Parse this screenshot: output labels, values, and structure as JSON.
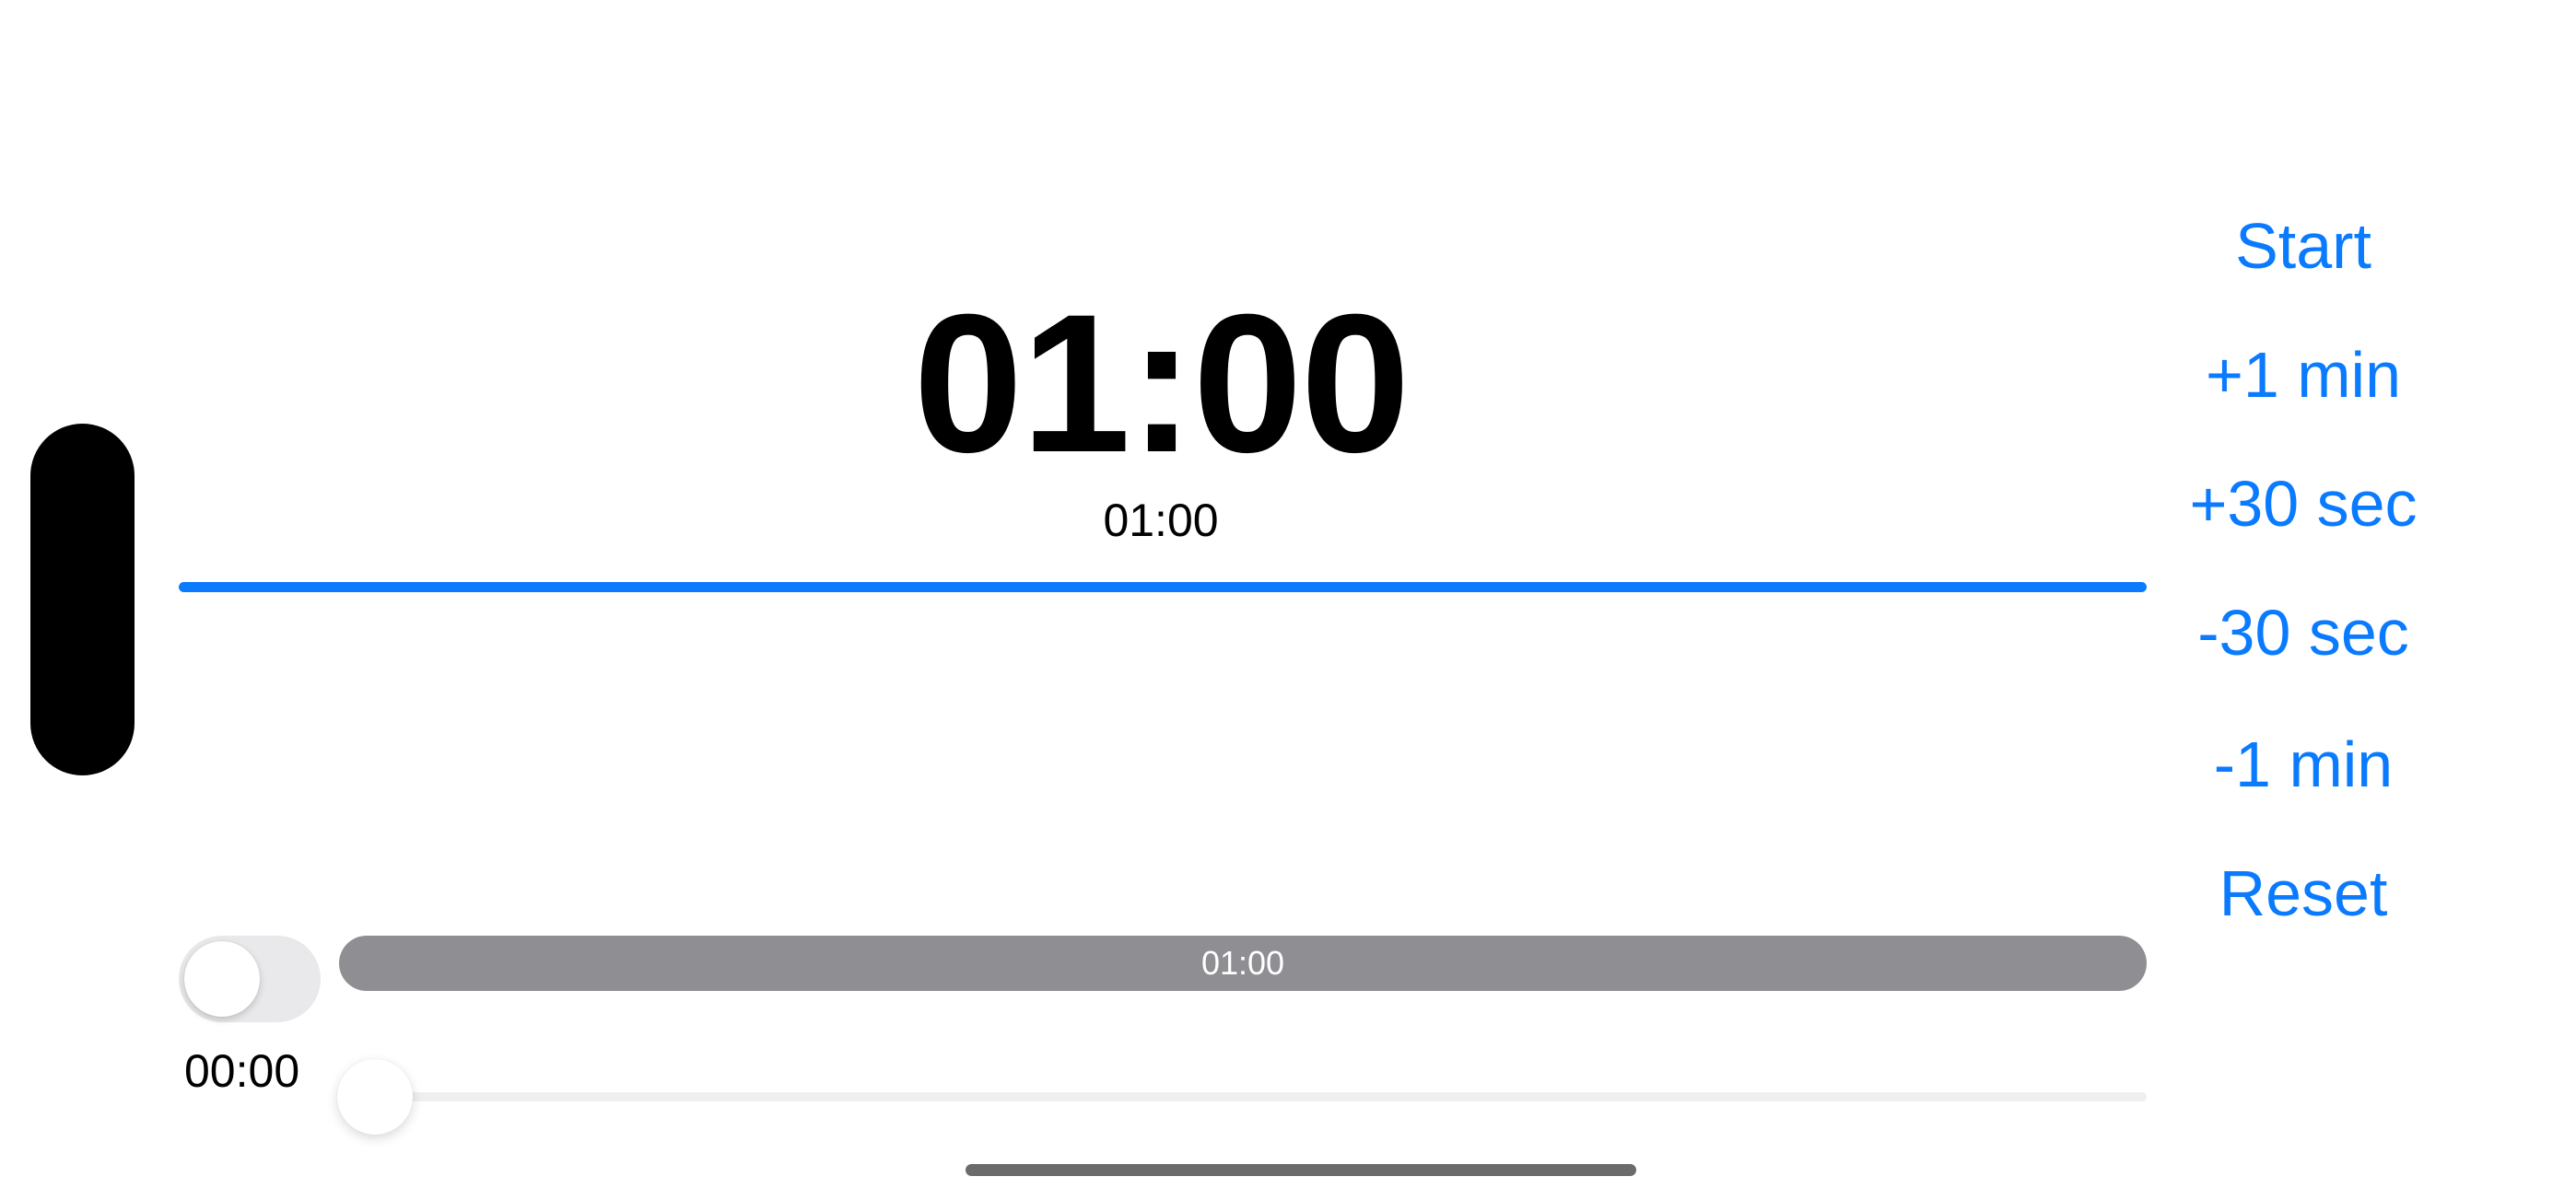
{
  "timer": {
    "main_time": "01:00",
    "sub_time": "01:00",
    "progress_fraction": 1.0
  },
  "controls": {
    "start_label": "Start",
    "plus_1_min_label": "+1 min",
    "plus_30_sec_label": "+30 sec",
    "minus_30_sec_label": "-30 sec",
    "minus_1_min_label": "-1 min",
    "reset_label": "Reset"
  },
  "bottom": {
    "toggle_on": false,
    "bar_label": "01:00",
    "elapsed_label": "00:00",
    "slider_fraction": 0.0
  },
  "colors": {
    "accent": "#0a7aff",
    "text": "#000000",
    "bar_gray": "#8e8e93",
    "toggle_off": "#e9e9eb"
  }
}
